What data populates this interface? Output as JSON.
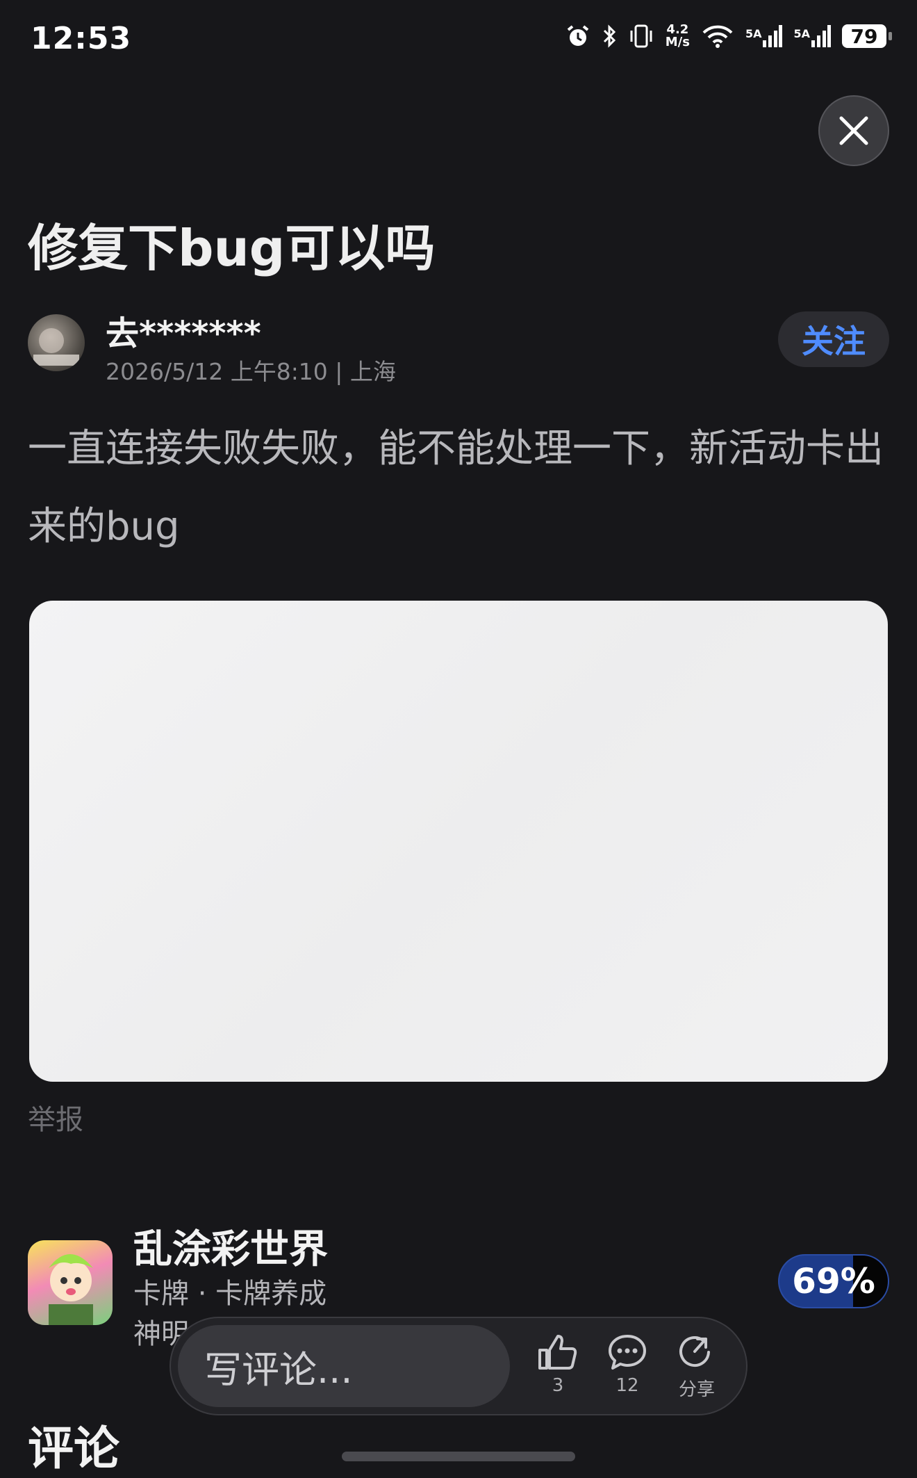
{
  "status_bar": {
    "time": "12:53",
    "net_speed_top": "4.2",
    "net_speed_bottom": "M/s",
    "sim1_label": "5A",
    "sim2_label": "5A",
    "battery": "79"
  },
  "post": {
    "title": "修复下bug可以吗",
    "author": "去*******",
    "meta": "2026/5/12 上午8:10 | 上海",
    "follow_label": "关注",
    "body": "一直连接失败失败，能不能处理一下，新活动卡出来的bug",
    "report_label": "举报"
  },
  "game": {
    "name": "乱涂彩世界",
    "tags": "卡牌 · 卡牌养成",
    "desc_visible": "神明",
    "rating": "69%"
  },
  "comments": {
    "heading": "评论"
  },
  "bottom_bar": {
    "input_placeholder": "写评论...",
    "like_count": "3",
    "comment_count": "12",
    "share_label": "分享"
  },
  "icons": {
    "close": "close-icon",
    "like": "thumbs-up-icon",
    "comment": "comment-bubble-icon",
    "share": "share-icon"
  },
  "colors": {
    "background": "#17171a",
    "accent": "#4f8cff",
    "rating_badge": "#1d3b8a"
  }
}
